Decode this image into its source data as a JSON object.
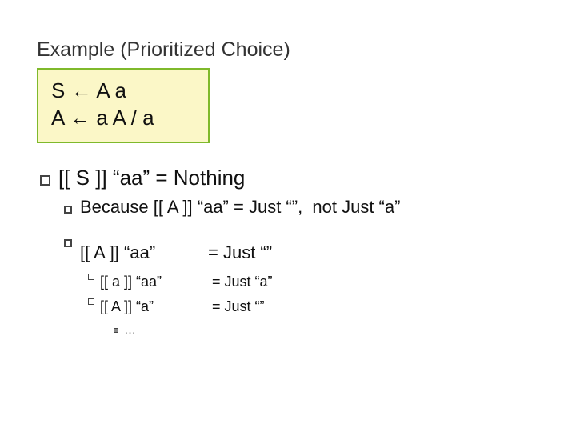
{
  "title": "Example (Prioritized Choice)",
  "grammar": {
    "line1": "S ← A a",
    "line2": "A ← a A / a"
  },
  "main": {
    "line": "[[ S ]] “aa” = Nothing",
    "because": "Because [[ A ]] “aa” = Just “”,  not Just “a”"
  },
  "steps": {
    "s1": {
      "left": "[[ A ]] “aa”",
      "right": "= Just “”"
    },
    "s2": {
      "left": "[[ a ]] “aa”",
      "right": "= Just “a”"
    },
    "s3": {
      "left": "[[ A ]] “a”",
      "right": "= Just “”"
    },
    "s4": "…"
  }
}
